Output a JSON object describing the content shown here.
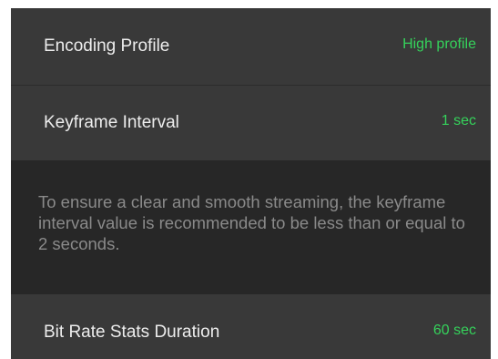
{
  "settings": {
    "encoding_profile": {
      "label": "Encoding Profile",
      "value": "High profile"
    },
    "keyframe_interval": {
      "label": "Keyframe Interval",
      "value": "1 sec"
    },
    "keyframe_hint": "To ensure a clear and smooth streaming, the keyframe interval value is recommended to be less than or equal to 2 seconds.",
    "bit_rate_stats_duration": {
      "label": "Bit Rate Stats Duration",
      "value": "60 sec"
    }
  },
  "colors": {
    "panel_background": "#393939",
    "hint_background": "#272727",
    "label_text": "#ededed",
    "value_accent": "#35d25b",
    "hint_text": "#8a8a8a"
  }
}
